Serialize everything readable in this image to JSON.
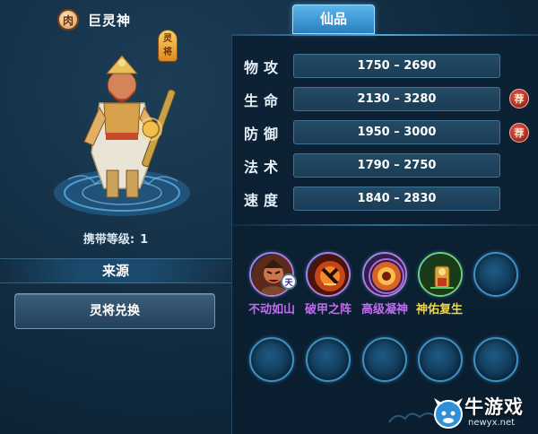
{
  "hero": {
    "name": "巨灵神",
    "type_badge": "肉",
    "rank_badge": [
      "灵",
      "将"
    ],
    "carry_level_label": "携带等级:",
    "carry_level_value": "1"
  },
  "source": {
    "title": "来源",
    "exchange_button": "灵将兑换"
  },
  "tabs": [
    {
      "label": "仙品",
      "active": true
    }
  ],
  "stats": [
    {
      "label": "物攻",
      "value": "1750 – 2690",
      "recommended": false
    },
    {
      "label": "生命",
      "value": "2130 – 3280",
      "recommended": true
    },
    {
      "label": "防御",
      "value": "1950 – 3000",
      "recommended": true
    },
    {
      "label": "法术",
      "value": "1790 – 2750",
      "recommended": false
    },
    {
      "label": "速度",
      "value": "1840 – 2830",
      "recommended": false
    }
  ],
  "recommend_badge": "荐",
  "skills": [
    {
      "name": "不动如山",
      "icon": "angry-warrior-icon",
      "color": "#c06df0",
      "badge": "天"
    },
    {
      "name": "破甲之阵",
      "icon": "shield-break-icon",
      "color": "#c06df0"
    },
    {
      "name": "高级凝神",
      "icon": "focus-orb-icon",
      "color": "#c06df0"
    },
    {
      "name": "神佑复生",
      "icon": "revive-idol-icon",
      "color": "#f2d24a"
    }
  ],
  "empty_skill_slots": 6,
  "watermark": {
    "brand": "牛游戏",
    "url": "newyx.net"
  },
  "colors": {
    "accent": "#4aa6de",
    "stat_box": "#244b66",
    "skill_purple": "#c06df0",
    "skill_gold": "#f2d24a"
  }
}
